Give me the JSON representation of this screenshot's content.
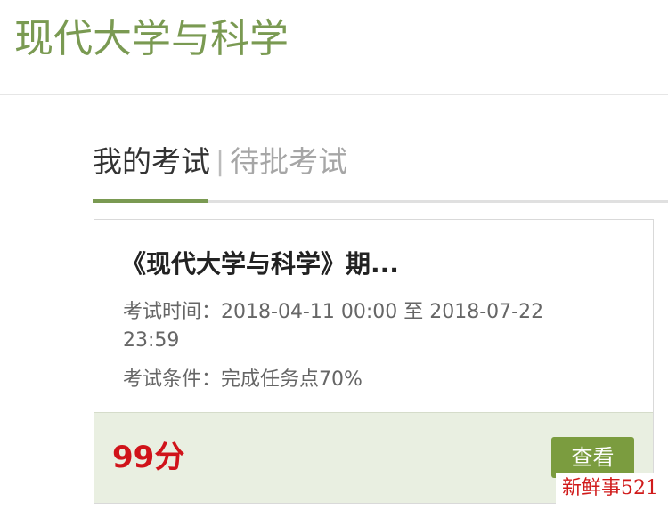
{
  "header": {
    "course_title": "现代大学与科学"
  },
  "tabs": [
    {
      "label": "我的考试",
      "active": true
    },
    {
      "label": "待批考试",
      "active": false
    }
  ],
  "tab_separator": "|",
  "exam_card": {
    "title": "《现代大学与科学》期...",
    "time_label": "考试时间：",
    "time_value": "2018-04-11 00:00 至 2018-07-22 23:59",
    "condition_label": "考试条件：",
    "condition_value": "完成任务点70%",
    "score": "99分",
    "view_button_label": "查看"
  },
  "watermark": "新鲜事521",
  "colors": {
    "accent_green": "#7a9a52",
    "button_green": "#7b9c3f",
    "score_red": "#d0131a",
    "footer_bg": "#e9efe1"
  }
}
